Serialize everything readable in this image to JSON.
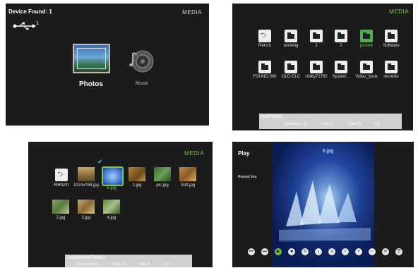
{
  "panel1": {
    "title": "Device Found:  1",
    "media": "MEDIA",
    "usb_count": "1",
    "photos_label": "Photos",
    "music_label": "Music"
  },
  "panel2": {
    "media": "MEDIA",
    "row1": [
      "Return",
      "working",
      "1",
      "2",
      "picture",
      "Software"
    ],
    "row2": [
      "FOUND.000",
      "OLD-DLC",
      "Utility71792",
      "System...",
      "Video_book",
      "moninfo"
    ],
    "path": "/usb/sda4",
    "directories": "Directories: 11",
    "files": "Files: 0",
    "total": "Total: 11",
    "page": "1/1"
  },
  "panel3": {
    "media": "MEDIA",
    "row1": [
      "Return",
      "1024x768.jpg",
      "6.jpg",
      "2.jpg",
      "pic.jpg",
      "Soft.jpg"
    ],
    "row2": [
      "2.jpg",
      "3.jpg",
      "4.jpg"
    ],
    "path": "/usb/sda4/Picture",
    "directories": "Directories: 0",
    "files": "Files: 8",
    "total": "Total: 8",
    "page": "1/1"
  },
  "panel4": {
    "play": "Play",
    "repeat": "Repeat:Seq",
    "filename": "6.jpg"
  },
  "colors": {
    "accent": "#7ac943",
    "background": "#1b1b1b"
  }
}
